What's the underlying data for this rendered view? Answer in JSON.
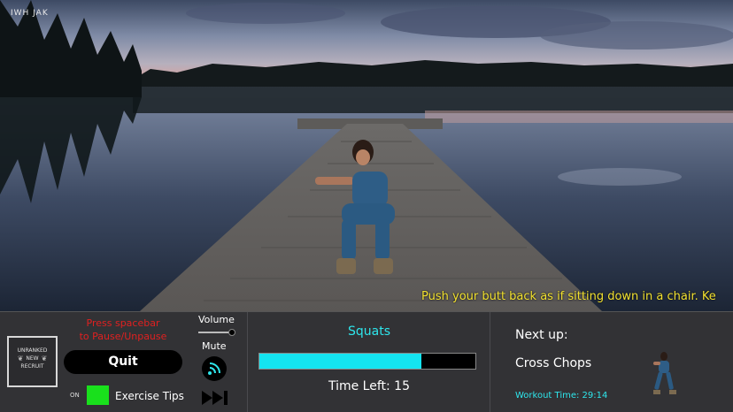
{
  "watermark": "IWH JAK",
  "tip_text": "Push your butt back as if sitting down in a chair. Ke",
  "rank": {
    "line1": "UNRANKED",
    "line2": "NEW",
    "line3": "RECRUIT"
  },
  "pause_hint": {
    "line1": "Press spacebar",
    "line2": "to Pause/Unpause"
  },
  "quit_label": "Quit",
  "tips_toggle": {
    "state_label": "ON",
    "label": "Exercise Tips",
    "enabled": true,
    "color": "#19e01c"
  },
  "audio": {
    "volume_label": "Volume",
    "volume_level": 1.0,
    "mute_label": "Mute"
  },
  "current_exercise": {
    "name": "Squats",
    "progress_percent": 75,
    "time_left": "Time Left: 15",
    "color": "#14e4f0"
  },
  "next": {
    "label": "Next up:",
    "name": "Cross Chops",
    "workout_time": "Workout Time: 29:14"
  },
  "icons": {
    "mute": "sound-waves-icon",
    "skip": "fast-forward-icon"
  }
}
